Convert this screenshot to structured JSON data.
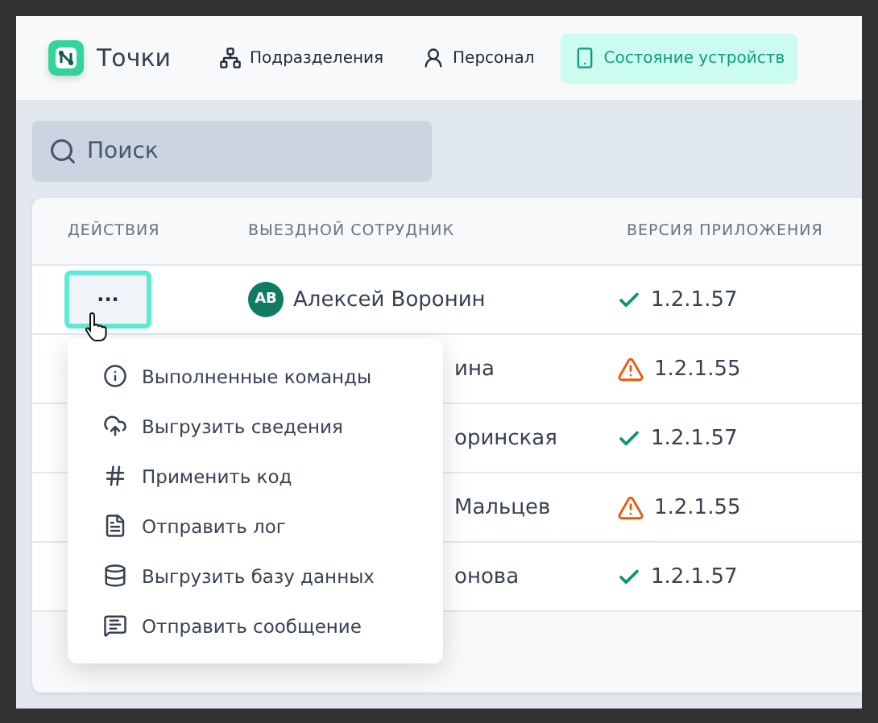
{
  "app": {
    "title": "Точки"
  },
  "nav": [
    {
      "label": "Подразделения",
      "selected": false
    },
    {
      "label": "Персонал",
      "selected": false
    },
    {
      "label": "Состояние устройств",
      "selected": true
    }
  ],
  "search": {
    "placeholder": "Поиск"
  },
  "table": {
    "columns": [
      "ДЕЙСТВИЯ",
      "ВЫЕЗДНОЙ СОТРУДНИК",
      "ВЕРСИЯ ПРИЛОЖЕНИЯ"
    ],
    "more_button": "···",
    "rows": [
      {
        "initials": "АВ",
        "name": "Алексей Воронин",
        "kind": "ok",
        "version": "1.2.1.57"
      },
      {
        "name": "ина",
        "kind": "warning",
        "version": "1.2.1.55"
      },
      {
        "name": "оринская",
        "kind": "ok",
        "version": "1.2.1.57"
      },
      {
        "name": "Мальцев",
        "kind": "warning",
        "version": "1.2.1.55"
      },
      {
        "name": "онова",
        "kind": "ok",
        "version": "1.2.1.57"
      }
    ]
  },
  "actions_menu": {
    "items": [
      "Выполненные команды",
      "Выгрузить сведения",
      "Применить код",
      "Отправить лог",
      "Выгрузить базу данных",
      "Отправить сообщение"
    ]
  }
}
